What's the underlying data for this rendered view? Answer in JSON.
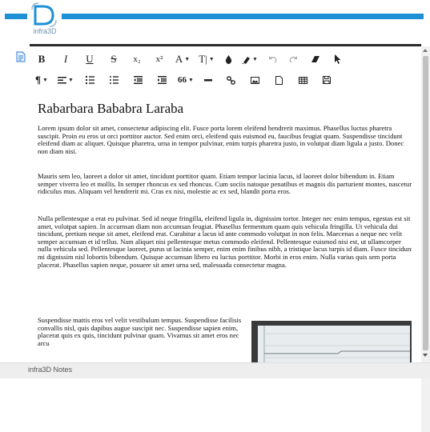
{
  "brand": {
    "logo_text": "infra3D",
    "accent_color": "#1e90d6"
  },
  "toolbar": {
    "row1": [
      {
        "name": "bold-button",
        "icon": "bold",
        "label": "B"
      },
      {
        "name": "italic-button",
        "icon": "italic",
        "label": "I"
      },
      {
        "name": "underline-button",
        "icon": "underline",
        "label": "U"
      },
      {
        "name": "strikethrough-button",
        "icon": "strikethrough",
        "label": "S"
      },
      {
        "name": "subscript-button",
        "icon": "subscript",
        "label": "x₂"
      },
      {
        "name": "superscript-button",
        "icon": "superscript",
        "label": "x²"
      },
      {
        "name": "font-size-button",
        "icon": "font-size",
        "label": "A"
      },
      {
        "name": "text-format-button",
        "icon": "text-format",
        "label": "T|"
      },
      {
        "name": "text-color-button",
        "icon": "color-drop"
      },
      {
        "name": "highlight-button",
        "icon": "marker"
      },
      {
        "name": "undo-button",
        "icon": "undo"
      },
      {
        "name": "redo-button",
        "icon": "redo"
      },
      {
        "name": "clear-format-button",
        "icon": "eraser"
      },
      {
        "name": "select-button",
        "icon": "cursor"
      }
    ],
    "row2": [
      {
        "name": "paragraph-button",
        "icon": "pilcrow",
        "label": "¶"
      },
      {
        "name": "align-button",
        "icon": "align"
      },
      {
        "name": "ordered-list-button",
        "icon": "ordered-list"
      },
      {
        "name": "unordered-list-button",
        "icon": "unordered-list"
      },
      {
        "name": "outdent-button",
        "icon": "outdent"
      },
      {
        "name": "indent-button",
        "icon": "indent"
      },
      {
        "name": "quote-button",
        "icon": "quote",
        "label": "66"
      },
      {
        "name": "horizontal-rule-button",
        "icon": "hr"
      },
      {
        "name": "link-button",
        "icon": "link"
      },
      {
        "name": "image-button",
        "icon": "image"
      },
      {
        "name": "file-button",
        "icon": "file"
      },
      {
        "name": "table-button",
        "icon": "table"
      },
      {
        "name": "save-button",
        "icon": "floppy"
      }
    ]
  },
  "document": {
    "title": "Rabarbara Bababra Laraba",
    "paragraphs": [
      "Lorem ipsum dolor sit amet, consectetur adipiscing elit. Fusce porta lorem eleifend hendrerit maximus. Phasellus luctus pharetra suscipit. Proin eu eros ut orci porttitor auctor. Sed enim orci, eleifend quis euismod eu, faucibus feugiat quam. Suspendisse tincidunt eleifend diam ac aliquet. Quisque pharetra, urna in tempor pulvinar, enim turpis pharetra justo, in volutpat diam ligula a justo. Donec non diam nisi.",
      "Mauris sem leo, laoreet a dolor sit amet, tincidunt porttitor quam. Etiam tempor lacinia lacus, id laoreet dolor bibendum in. Etiam semper viverra leo et mollis. In semper rhoncus ex sed rhoncus. Cum sociis natoque penatibus et magnis dis parturient montes, nascetur ridiculus mus. Aliquam vel hendrerit mi. Cras ex nisi, molestie ac ex sed, blandit porta eros.",
      "Nulla pellentesque a erat eu pulvinar. Sed id neque fringilla, eleifend ligula in, dignissim tortor. Integer nec enim tempus, egestas est sit amet, volutpat sapien. In accumsan diam non accumsan feugiat. Phasellus fermentum quam quis vehicula fringilla. Ut vehicula dui tincidunt, pretium neque sit amet, eleifend erat. Curabitur a lacus id ante commodo volutpat in non felis. Maecenas a neque nec velit semper accumsan et id tellus. Nam aliquet nisi pellentesque metus commodo eleifend. Pellentesque euismod nisi est, ut ullamcorper nulla vehicula sed. Pellentesque laoreet, purus ut lacinia semper, enim enim finibus nibh, a tristique lacus turpis id diam. Fusce tincidunt mi dignissim nisl lobortis bibendum. Quisque accumsan libero eu luctus porttitor. Morbi in eros enim. Nulla varius quis sem porta placerat. Phasellus sapien neque, posuere sit amet urna sed, malesuada consectetur magna.",
      "Suspendisse mattis eros vel velit vestibulum tempus. Suspendisse facilisis convallis nisl, quis dapibus augue suscipit nec. Suspendisse sapien enim, placerat quis ex quis, tincidunt pulvinar quam. Vivamus sit amet eros nec arcu"
    ]
  },
  "footer": {
    "label": "infra3D Notes"
  }
}
